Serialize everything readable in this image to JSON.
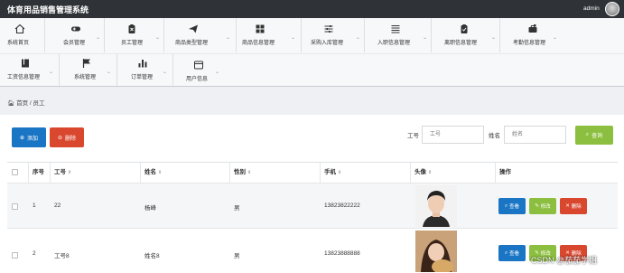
{
  "app": {
    "title": "体育用品销售管理系统",
    "user": "admin"
  },
  "nav": {
    "row1": [
      {
        "label": "系统首页",
        "icon": "home-icon"
      },
      {
        "label": "会员管理",
        "icon": "gamepad-icon"
      },
      {
        "label": "员工管理",
        "icon": "clipboard-x-icon"
      },
      {
        "label": "商品类型管理",
        "icon": "paper-plane-icon"
      },
      {
        "label": "商品信息管理",
        "icon": "grid-icon"
      },
      {
        "label": "采购入库管理",
        "icon": "sliders-icon"
      },
      {
        "label": "入职信息管理",
        "icon": "list-icon"
      },
      {
        "label": "离职信息管理",
        "icon": "clipboard-check-icon"
      },
      {
        "label": "考勤信息管理",
        "icon": "briefcase-icon"
      }
    ],
    "row2": [
      {
        "label": "工资信息管理",
        "icon": "book-icon"
      },
      {
        "label": "系统管理",
        "icon": "flag-icon"
      },
      {
        "label": "订单管理",
        "icon": "bar-chart-icon"
      },
      {
        "label": "用户信息",
        "icon": "window-icon"
      }
    ]
  },
  "breadcrumb": {
    "home": "首页",
    "current": "员工"
  },
  "toolbar": {
    "add": "添加",
    "delete": "删除",
    "search": "查询"
  },
  "filters": {
    "emp_no_label": "工号",
    "emp_no_placeholder": "工号",
    "name_label": "姓名",
    "name_placeholder": "姓名"
  },
  "table": {
    "headers": [
      "序号",
      "工号",
      "姓名",
      "性别",
      "手机",
      "头像",
      "操作"
    ],
    "rows": [
      {
        "index": "1",
        "emp_no": "22",
        "name": "杨峰",
        "gender": "男",
        "phone": "13823822222"
      },
      {
        "index": "2",
        "emp_no": "工号8",
        "name": "姓名8",
        "gender": "男",
        "phone": "13823888888"
      }
    ],
    "actions": {
      "view": "查看",
      "edit": "修改",
      "remove": "删除"
    }
  },
  "colors": {
    "topbar": "#2f3236",
    "primary": "#1a75c4",
    "danger": "#d9472f",
    "success": "#8cbf3f"
  },
  "watermark": "CSDN @茄茄学姐"
}
